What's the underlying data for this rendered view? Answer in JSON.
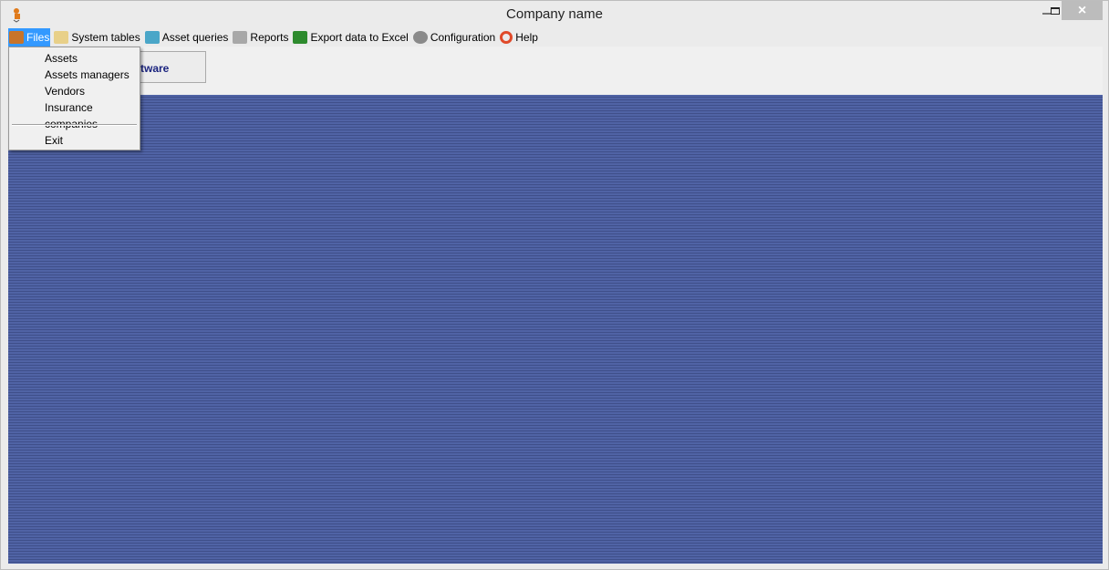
{
  "window": {
    "title": "Company name",
    "controls": {
      "minimize": "minimize-icon",
      "maximize": "maximize-icon",
      "close": "×"
    }
  },
  "menubar": [
    {
      "label": "Files",
      "icon": "briefcase-icon",
      "color": "#c8742a"
    },
    {
      "label": "System tables",
      "icon": "folder-icon",
      "color": "#e8d089"
    },
    {
      "label": "Asset queries",
      "icon": "monitor-icon",
      "color": "#4aa6c8"
    },
    {
      "label": "Reports",
      "icon": "printer-icon",
      "color": "#9a9a9a"
    },
    {
      "label": "Export data to Excel",
      "icon": "excel-icon",
      "color": "#2e8b2e"
    },
    {
      "label": "Configuration",
      "icon": "disk-icon",
      "color": "#8a8a8a"
    },
    {
      "label": "Help",
      "icon": "lifebuoy-icon",
      "color": "#e04a2a"
    }
  ],
  "files_menu": {
    "items": [
      "Assets",
      "Assets managers",
      "Vendors",
      "Insurance companies"
    ],
    "exit": "Exit"
  },
  "toolbar": {
    "button_label": "ftware"
  },
  "colors": {
    "highlight": "#3399ff",
    "desktop": "#4a5b9a"
  }
}
